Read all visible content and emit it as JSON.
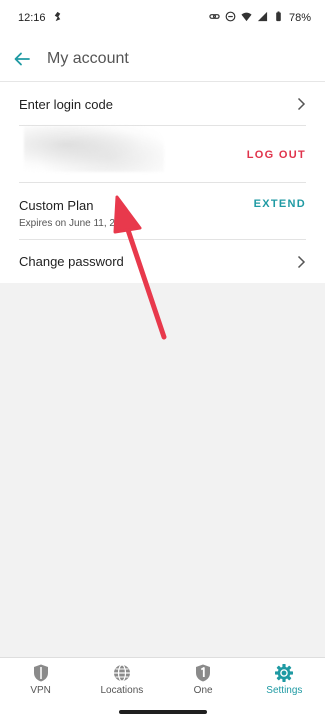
{
  "status_bar": {
    "time": "12:16",
    "battery": "78%"
  },
  "app_bar": {
    "title": "My account"
  },
  "rows": {
    "login_code": {
      "label": "Enter login code"
    },
    "account": {
      "action": "LOG OUT"
    },
    "plan": {
      "label": "Custom Plan",
      "expires": "Expires on June 11, 2024",
      "action": "EXTEND"
    },
    "password": {
      "label": "Change password"
    }
  },
  "bottom_nav": {
    "items": [
      {
        "label": "VPN",
        "icon": "shield-icon"
      },
      {
        "label": "Locations",
        "icon": "globe-icon"
      },
      {
        "label": "One",
        "icon": "shield-one-icon"
      },
      {
        "label": "Settings",
        "icon": "gear-icon",
        "active": true
      }
    ]
  },
  "colors": {
    "accent": "#1f9aa3",
    "logout": "#e0334b",
    "annotation_arrow": "#e8394c"
  }
}
